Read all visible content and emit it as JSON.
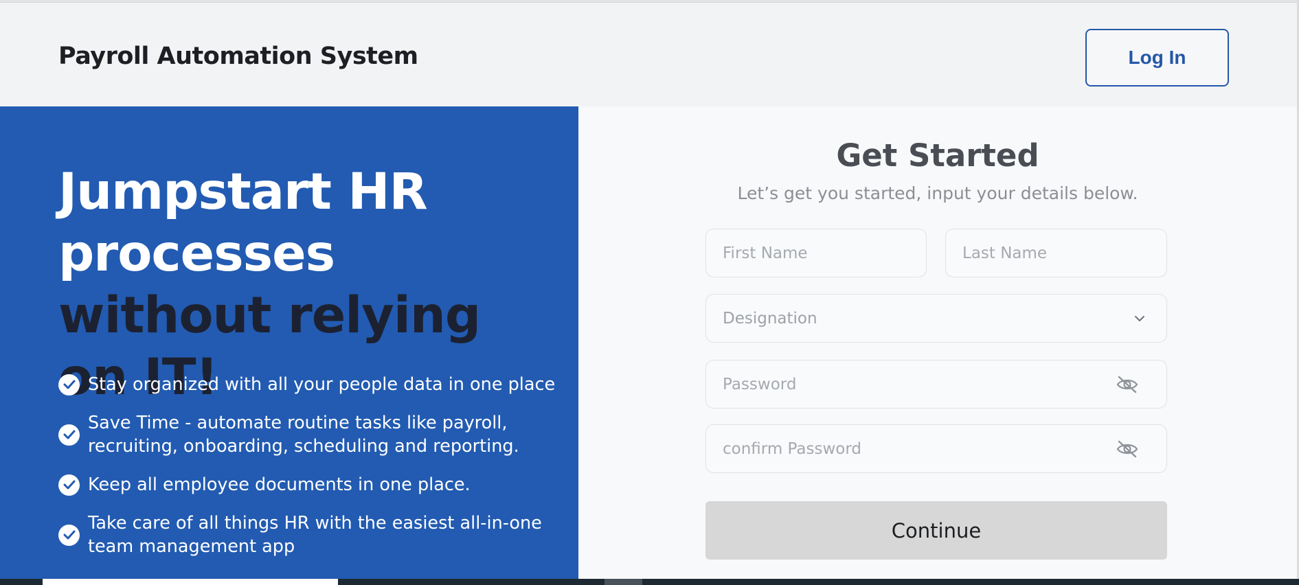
{
  "header": {
    "app_title": "Payroll Automation System",
    "login_label": "Log In"
  },
  "hero": {
    "line_white": "Jumpstart HR processes",
    "line_dark": "without relying on IT!"
  },
  "features": [
    "Stay organized with all your people data in one place",
    "Save Time - automate routine tasks like payroll, recruiting, onboarding, scheduling and reporting.",
    "Keep all employee documents in one place.",
    "Take care of all things HR with the easiest all-in-one team management app"
  ],
  "form": {
    "title": "Get Started",
    "subtitle": "Let’s get you started, input your details below.",
    "first_name_placeholder": "First Name",
    "last_name_placeholder": "Last Name",
    "designation_selected": "Designation",
    "password_placeholder": "Password",
    "confirm_password_placeholder": "confirm Password",
    "continue_label": "Continue"
  },
  "colors": {
    "brand_blue": "#225bb1",
    "login_border": "#2457a8",
    "hero_dark": "#1c2132",
    "button_gray": "#d7d7d7"
  },
  "icons": {
    "check": "check-circle-icon",
    "dropdown": "chevron-down-icon",
    "password_toggle": "eye-off-icon"
  }
}
